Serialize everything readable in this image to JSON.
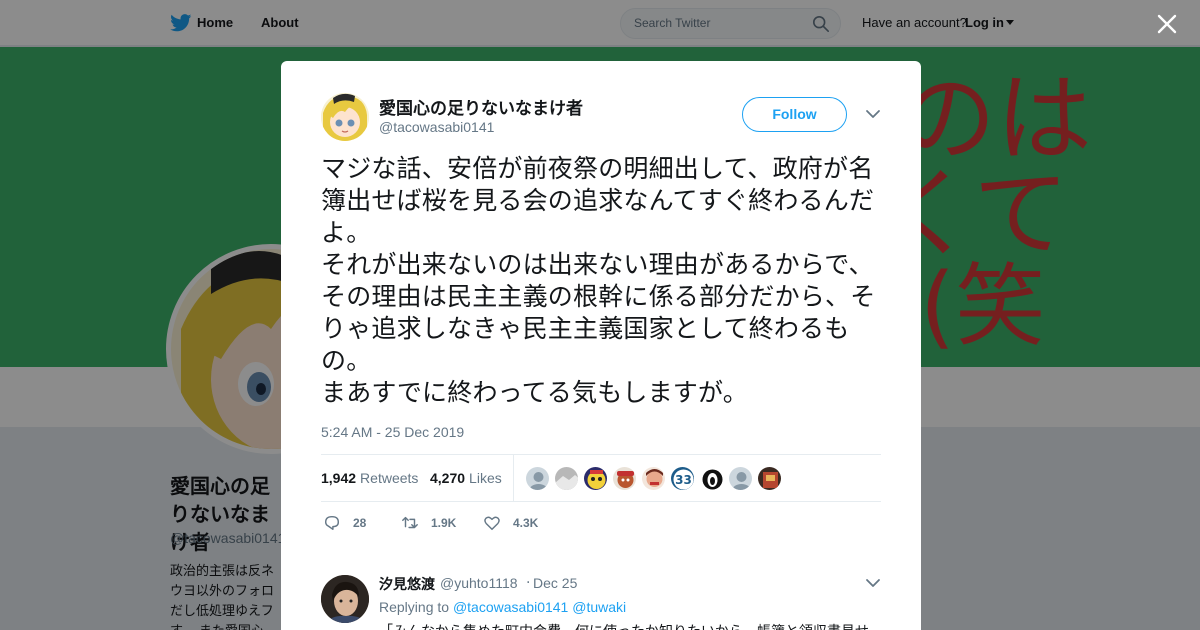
{
  "topbar": {
    "home_label": "Home",
    "about_label": "About",
    "search_placeholder": "Search Twitter",
    "account_question": "Have an account?",
    "login_label": "Log in"
  },
  "profile": {
    "name": "愛国心の足りないなまけ者",
    "handle": "@tacowasabi0141",
    "bio": "政治的主張は反ネ ウヨ以外のフォロ だし低処理ゆえフ す。 また愛国心",
    "banner_color": "#3db36a",
    "banner_text": [
      "のは",
      "くて",
      "(笑"
    ]
  },
  "tweet": {
    "author_name": "愛国心の足りないなまけ者",
    "author_handle": "@tacowasabi0141",
    "follow_label": "Follow",
    "text": "マジな話、安倍が前夜祭の明細出して、政府が名簿出せば桜を見る会の追求なんてすぐ終わるんだよ。\nそれが出来ないのは出来ない理由があるからで、その理由は民主主義の根幹に係る部分だから、そりゃ追求しなきゃ民主主義国家として終わるもの。\nまあすでに終わってる気もしますが。",
    "timestamp": "5:24 AM - 25 Dec 2019",
    "retweets_count": "1,942",
    "retweets_label": "Retweets",
    "likes_count": "4,270",
    "likes_label": "Likes",
    "liker_avatars": [
      "avatar-1",
      "avatar-2",
      "avatar-3",
      "avatar-4",
      "avatar-5",
      "avatar-6",
      "avatar-7",
      "avatar-8",
      "avatar-9"
    ],
    "reply_count": "28",
    "retweet_short": "1.9K",
    "like_short": "4.3K"
  },
  "reply": {
    "name": "汐見悠渡",
    "handle": "@yuhto1118",
    "separator": "·",
    "date": "Dec 25",
    "replying_to_label": "Replying to",
    "replying_to_users": [
      "@tacowasabi0141",
      "@tuwaki"
    ],
    "text": "「みんなから集めた町内会費、何に使ったか知りたいから、帳簿と領収書見せ"
  },
  "colors": {
    "accent": "#1da1f2",
    "overlay": "rgba(0,0,0,0.45)"
  }
}
